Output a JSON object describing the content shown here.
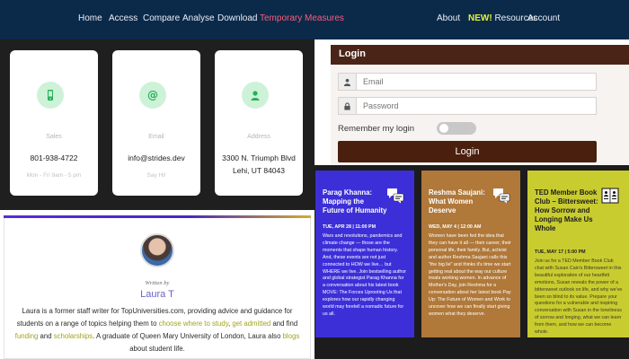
{
  "nav": {
    "left": [
      "Home",
      "Access",
      "Compare",
      "Analyse",
      "Download",
      "Temporary Measures"
    ],
    "about": "About",
    "new_badge": "NEW!",
    "resources": "Resources",
    "account": "Account",
    "active_item": "Temporary Measures",
    "colors": {
      "bar": "#0b2a4a",
      "active": "#ff5a7a",
      "new": "#e4f23a"
    }
  },
  "contacts": [
    {
      "icon": "phone-icon",
      "label": "Sales",
      "value": "801-938-4722",
      "value2": "",
      "note": "Mon - Fri 9am - 5 pm"
    },
    {
      "icon": "at-sign-icon",
      "label": "Email",
      "value": "info@strides.dev",
      "value2": "",
      "note": "Say Hi!"
    },
    {
      "icon": "user-pin-icon",
      "label": "Address",
      "value": "3300 N. Triumph Blvd",
      "value2": "Lehi, UT 84043",
      "note": ""
    }
  ],
  "login": {
    "title": "Login",
    "email_placeholder": "Email",
    "password_placeholder": "Password",
    "remember_label": "Remember my login",
    "remember_checked": false,
    "button_label": "Login",
    "colors": {
      "header": "#4a2517",
      "button": "#4a1f0e"
    }
  },
  "author": {
    "written_by": "Written by",
    "name": "Laura T",
    "bio": {
      "p1": "Laura is a former staff writer for TopUniversities.com, providing advice and guidance for students on a range of topics helping them to ",
      "link1": "choose where to study",
      "p2": ", ",
      "link2": "get admitted",
      "p3": " and find ",
      "link3": "funding",
      "p4": " and ",
      "link4": "scholarships",
      "p5": ". A graduate of Queen Mary University of London, Laura also ",
      "link5": "blogs",
      "p6": " about student life."
    }
  },
  "events": [
    {
      "title": "Parag Khanna: Mapping the Future of Humanity",
      "date": "TUE, APR 28 | 11:00 PM",
      "description": "Wars and revolutions, pandemics and climate change — those are the moments that shape human history. And, these events are not just connected to HOW we live… but WHERE we live. Join bestselling author and global strategist Parag Khanna for a conversation about his latest book MOVE: The Forces Uprooting Us that explores how our rapidly changing world may foretell a nomadic future for us all.",
      "icon": "chat-bubbles-icon",
      "color": "#3c2fd8"
    },
    {
      "title": "Reshma Saujani: What Women Deserve",
      "date": "WED, MAY 4 | 12:00 AM",
      "description": "Women have been fed the idea that they can have it all — their career, their personal life, their family. But, activist and author Reshma Saujani calls this \"the big lie\" and thinks it's time we start getting real about the way our culture treats working women. In advance of Mother's Day, join Reshma for a conversation about her latest book Pay Up: The Future of Women and Work to uncover how we can finally start giving women what they deserve.",
      "icon": "chat-bubbles-icon",
      "color": "#b07839"
    },
    {
      "title": "TED Member Book Club – Bittersweet: How Sorrow and Longing Make Us Whole",
      "date": "TUE, MAY 17 | 5:00 PM",
      "description": "Join us for a TED Member Book Club chat with Susan Cain's Bittersweet in this beautiful exploration of our heartfelt emotions, Susan reveals the power of a bittersweet outlook on life, and why we've been so blind to its value. Prepare your questions for a vulnerable and inspiring conversation with Susan in the loneliness of sorrow and longing, what we can learn from them, and how we can become whole.",
      "icon": "book-club-icon",
      "color": "#c9cc2f"
    }
  ]
}
